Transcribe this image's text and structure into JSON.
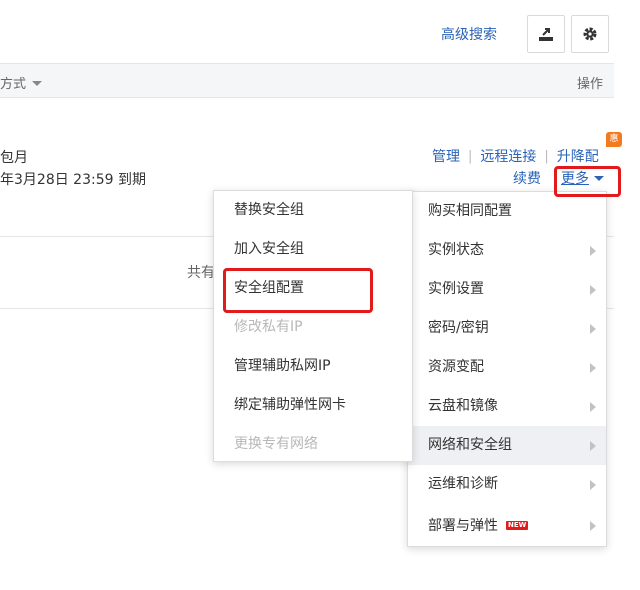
{
  "header": {
    "advanced_search": "高级搜索",
    "export_icon": "export-icon",
    "settings_icon": "gear-icon"
  },
  "table": {
    "pay_column": "方式",
    "ops_column": "操作",
    "total_partial": "共有"
  },
  "row": {
    "billing_type": "包月",
    "expiry": "年3月28日 23:59 到期",
    "links": {
      "manage": "管理",
      "remote_connect": "远程连接",
      "upgrade": "升降配",
      "renew": "续费",
      "more": "更多",
      "promo_badge": "惠"
    }
  },
  "more_menu": {
    "items": [
      {
        "label": "购买相同配置",
        "submenu": false
      },
      {
        "label": "实例状态",
        "submenu": true
      },
      {
        "label": "实例设置",
        "submenu": true
      },
      {
        "label": "密码/密钥",
        "submenu": true
      },
      {
        "label": "资源变配",
        "submenu": true
      },
      {
        "label": "云盘和镜像",
        "submenu": true
      },
      {
        "label": "网络和安全组",
        "submenu": true,
        "active": true
      },
      {
        "label": "运维和诊断",
        "submenu": true
      },
      {
        "label": "部署与弹性",
        "submenu": true,
        "badge": "NEW"
      }
    ]
  },
  "network_submenu": {
    "items": [
      {
        "label": "替换安全组",
        "disabled": false
      },
      {
        "label": "加入安全组",
        "disabled": false
      },
      {
        "label": "安全组配置",
        "disabled": false,
        "highlighted": true
      },
      {
        "label": "修改私有IP",
        "disabled": true
      },
      {
        "label": "管理辅助私网IP",
        "disabled": false
      },
      {
        "label": "绑定辅助弹性网卡",
        "disabled": false
      },
      {
        "label": "更换专有网络",
        "disabled": true
      }
    ]
  },
  "colors": {
    "link": "#2a63b8",
    "highlight_border": "#e11b1b",
    "promo": "#f47a1f"
  }
}
